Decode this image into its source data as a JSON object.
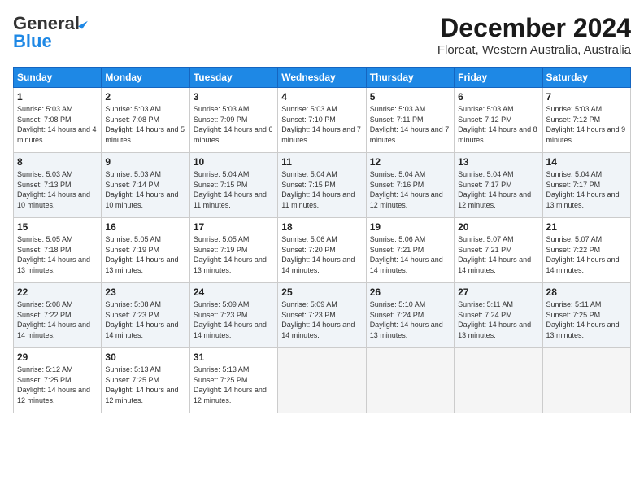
{
  "header": {
    "logo_general": "General",
    "logo_blue": "Blue",
    "month_title": "December 2024",
    "location": "Floreat, Western Australia, Australia"
  },
  "weekdays": [
    "Sunday",
    "Monday",
    "Tuesday",
    "Wednesday",
    "Thursday",
    "Friday",
    "Saturday"
  ],
  "weeks": [
    [
      {
        "day": "1",
        "sunrise": "5:03 AM",
        "sunset": "7:08 PM",
        "daylight": "14 hours and 4 minutes."
      },
      {
        "day": "2",
        "sunrise": "5:03 AM",
        "sunset": "7:08 PM",
        "daylight": "14 hours and 5 minutes."
      },
      {
        "day": "3",
        "sunrise": "5:03 AM",
        "sunset": "7:09 PM",
        "daylight": "14 hours and 6 minutes."
      },
      {
        "day": "4",
        "sunrise": "5:03 AM",
        "sunset": "7:10 PM",
        "daylight": "14 hours and 7 minutes."
      },
      {
        "day": "5",
        "sunrise": "5:03 AM",
        "sunset": "7:11 PM",
        "daylight": "14 hours and 7 minutes."
      },
      {
        "day": "6",
        "sunrise": "5:03 AM",
        "sunset": "7:12 PM",
        "daylight": "14 hours and 8 minutes."
      },
      {
        "day": "7",
        "sunrise": "5:03 AM",
        "sunset": "7:12 PM",
        "daylight": "14 hours and 9 minutes."
      }
    ],
    [
      {
        "day": "8",
        "sunrise": "5:03 AM",
        "sunset": "7:13 PM",
        "daylight": "14 hours and 10 minutes."
      },
      {
        "day": "9",
        "sunrise": "5:03 AM",
        "sunset": "7:14 PM",
        "daylight": "14 hours and 10 minutes."
      },
      {
        "day": "10",
        "sunrise": "5:04 AM",
        "sunset": "7:15 PM",
        "daylight": "14 hours and 11 minutes."
      },
      {
        "day": "11",
        "sunrise": "5:04 AM",
        "sunset": "7:15 PM",
        "daylight": "14 hours and 11 minutes."
      },
      {
        "day": "12",
        "sunrise": "5:04 AM",
        "sunset": "7:16 PM",
        "daylight": "14 hours and 12 minutes."
      },
      {
        "day": "13",
        "sunrise": "5:04 AM",
        "sunset": "7:17 PM",
        "daylight": "14 hours and 12 minutes."
      },
      {
        "day": "14",
        "sunrise": "5:04 AM",
        "sunset": "7:17 PM",
        "daylight": "14 hours and 13 minutes."
      }
    ],
    [
      {
        "day": "15",
        "sunrise": "5:05 AM",
        "sunset": "7:18 PM",
        "daylight": "14 hours and 13 minutes."
      },
      {
        "day": "16",
        "sunrise": "5:05 AM",
        "sunset": "7:19 PM",
        "daylight": "14 hours and 13 minutes."
      },
      {
        "day": "17",
        "sunrise": "5:05 AM",
        "sunset": "7:19 PM",
        "daylight": "14 hours and 13 minutes."
      },
      {
        "day": "18",
        "sunrise": "5:06 AM",
        "sunset": "7:20 PM",
        "daylight": "14 hours and 14 minutes."
      },
      {
        "day": "19",
        "sunrise": "5:06 AM",
        "sunset": "7:21 PM",
        "daylight": "14 hours and 14 minutes."
      },
      {
        "day": "20",
        "sunrise": "5:07 AM",
        "sunset": "7:21 PM",
        "daylight": "14 hours and 14 minutes."
      },
      {
        "day": "21",
        "sunrise": "5:07 AM",
        "sunset": "7:22 PM",
        "daylight": "14 hours and 14 minutes."
      }
    ],
    [
      {
        "day": "22",
        "sunrise": "5:08 AM",
        "sunset": "7:22 PM",
        "daylight": "14 hours and 14 minutes."
      },
      {
        "day": "23",
        "sunrise": "5:08 AM",
        "sunset": "7:23 PM",
        "daylight": "14 hours and 14 minutes."
      },
      {
        "day": "24",
        "sunrise": "5:09 AM",
        "sunset": "7:23 PM",
        "daylight": "14 hours and 14 minutes."
      },
      {
        "day": "25",
        "sunrise": "5:09 AM",
        "sunset": "7:23 PM",
        "daylight": "14 hours and 14 minutes."
      },
      {
        "day": "26",
        "sunrise": "5:10 AM",
        "sunset": "7:24 PM",
        "daylight": "14 hours and 13 minutes."
      },
      {
        "day": "27",
        "sunrise": "5:11 AM",
        "sunset": "7:24 PM",
        "daylight": "14 hours and 13 minutes."
      },
      {
        "day": "28",
        "sunrise": "5:11 AM",
        "sunset": "7:25 PM",
        "daylight": "14 hours and 13 minutes."
      }
    ],
    [
      {
        "day": "29",
        "sunrise": "5:12 AM",
        "sunset": "7:25 PM",
        "daylight": "14 hours and 12 minutes."
      },
      {
        "day": "30",
        "sunrise": "5:13 AM",
        "sunset": "7:25 PM",
        "daylight": "14 hours and 12 minutes."
      },
      {
        "day": "31",
        "sunrise": "5:13 AM",
        "sunset": "7:25 PM",
        "daylight": "14 hours and 12 minutes."
      },
      null,
      null,
      null,
      null
    ]
  ]
}
